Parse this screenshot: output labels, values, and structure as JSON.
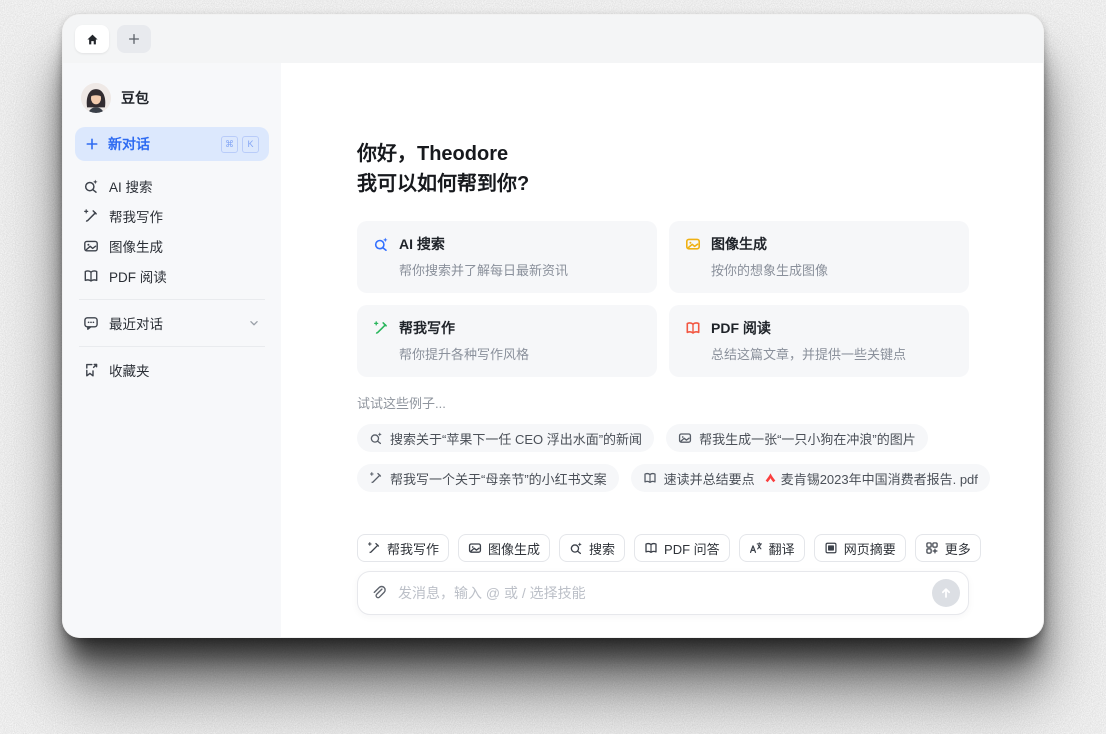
{
  "colors": {
    "accent_blue": "#3370ff",
    "new_chat_bg": "#dce8fd",
    "green": "#2ab65d",
    "yellow": "#efb114",
    "red": "#f25742",
    "adobe_red": "#fa3e3e",
    "sidebar_bg": "#f7f8fa",
    "tabbar_bg": "#f4f5f6",
    "card_bg": "#f6f7f9",
    "text_primary": "#1f2329",
    "text_secondary": "#8a909b",
    "placeholder": "#bcc0c8"
  },
  "icons": {
    "home-icon": "house",
    "new-tab-plus-icon": "+",
    "plus-icon": "+",
    "ai-search-icon": "magnifier with sparkle",
    "write-icon": "pencil with sparkle",
    "image-icon": "photo frame",
    "book-icon": "open book",
    "chat-icon": "speech bubble",
    "bookmark-icon": "bookmark with arrow",
    "chevron-down-icon": "v",
    "translate-icon": "A/文",
    "webpage-icon": "browser document",
    "more-icon": "grid plus",
    "paperclip-icon": "paperclip",
    "send-icon": "up arrow",
    "adobe-pdf-icon": "red pdf logo"
  },
  "sidebar": {
    "profile_name": "豆包",
    "new_chat": {
      "label": "新对话",
      "shortcut_cmd": "⌘",
      "shortcut_key": "K"
    },
    "items": [
      {
        "label": "AI 搜索"
      },
      {
        "label": "帮我写作"
      },
      {
        "label": "图像生成"
      },
      {
        "label": "PDF 阅读"
      }
    ],
    "recent_label": "最近对话",
    "favorites_label": "收藏夹"
  },
  "main": {
    "greeting_line1": "你好，Theodore",
    "greeting_line2": "我可以如何帮到你?",
    "cards": [
      {
        "title": "AI 搜索",
        "desc": "帮你搜索并了解每日最新资讯"
      },
      {
        "title": "图像生成",
        "desc": "按你的想象生成图像"
      },
      {
        "title": "帮我写作",
        "desc": "帮你提升各种写作风格"
      },
      {
        "title": "PDF 阅读",
        "desc": "总结这篇文章，并提供一些关键点"
      }
    ],
    "examples_title": "试试这些例子...",
    "examples": [
      {
        "label": "搜索关于“苹果下一任 CEO 浮出水面”的新闻"
      },
      {
        "label": "帮我生成一张“一只小狗在冲浪”的图片"
      },
      {
        "label": "帮我写一个关于“母亲节”的小红书文案"
      },
      {
        "label": "速读并总结要点",
        "attachment": "麦肯锡2023年中国消费者报告. pdf"
      }
    ]
  },
  "composer": {
    "skills": [
      {
        "label": "帮我写作"
      },
      {
        "label": "图像生成"
      },
      {
        "label": "搜索"
      },
      {
        "label": "PDF 问答"
      },
      {
        "label": "翻译"
      },
      {
        "label": "网页摘要"
      },
      {
        "label": "更多"
      }
    ],
    "placeholder": "发消息，输入 @ 或 / 选择技能"
  }
}
